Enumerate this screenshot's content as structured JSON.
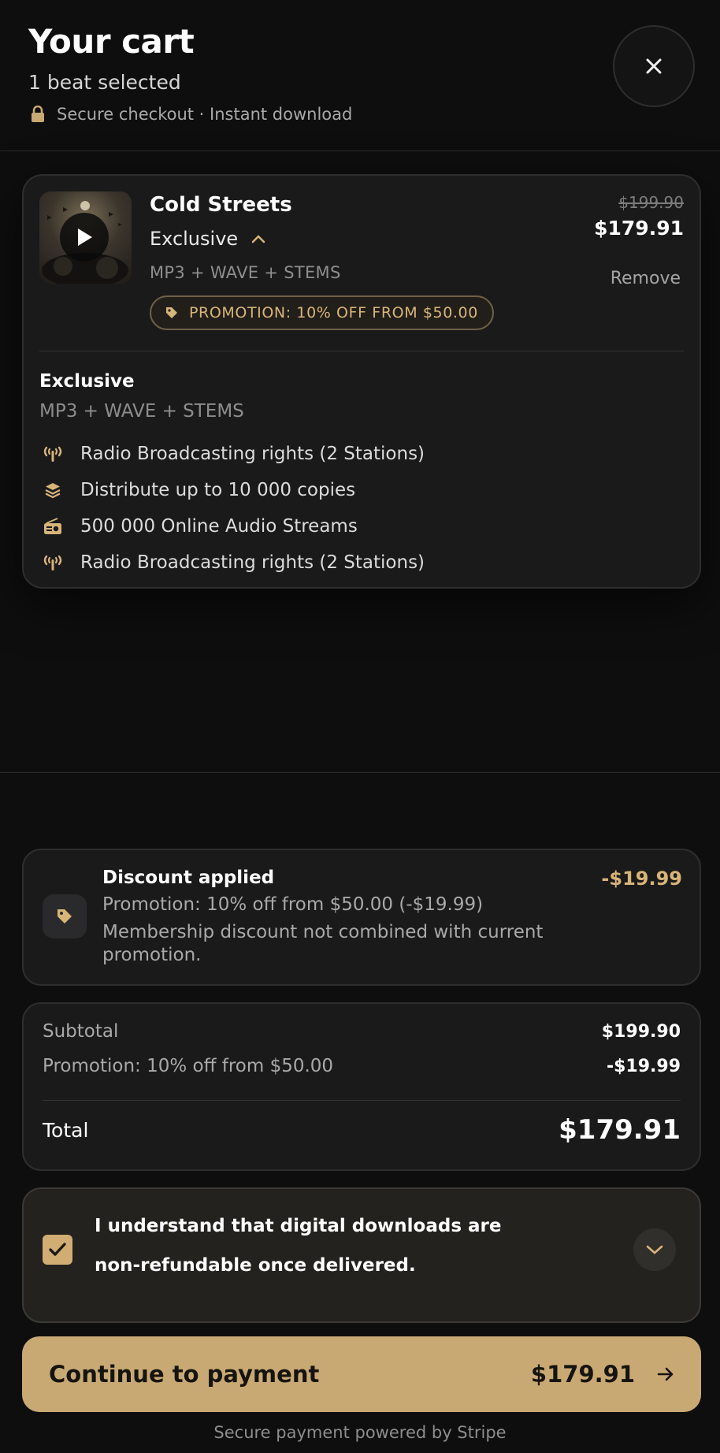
{
  "header": {
    "title": "Your cart",
    "subtitle": "1 beat selected",
    "secure_text": "Secure checkout · Instant download"
  },
  "item": {
    "name": "Cold Streets",
    "license": "Exclusive",
    "formats": "MP3 + WAVE + STEMS",
    "promo_pill": "PROMOTION: 10% OFF FROM $50.00",
    "old_price": "$199.90",
    "new_price": "$179.91",
    "remove_label": "Remove",
    "details": {
      "title": "Exclusive",
      "formats": "MP3 + WAVE + STEMS",
      "features": [
        {
          "icon": "radio-antenna-icon",
          "text": "Radio Broadcasting rights (2 Stations)"
        },
        {
          "icon": "layers-icon",
          "text": "Distribute up to 10 000 copies"
        },
        {
          "icon": "radio-icon",
          "text": "500 000 Online Audio Streams"
        },
        {
          "icon": "radio-antenna-icon",
          "text": "Radio Broadcasting rights (2 Stations)"
        }
      ]
    }
  },
  "discount": {
    "title": "Discount applied",
    "line1": "Promotion: 10% off from $50.00 (-$19.99)",
    "line2": "Membership discount not combined with current promotion.",
    "amount": "-$19.99"
  },
  "summary": {
    "subtotal_label": "Subtotal",
    "subtotal_value": "$199.90",
    "promo_label": "Promotion: 10% off from $50.00",
    "promo_value": "-$19.99",
    "total_label": "Total",
    "total_value": "$179.91"
  },
  "consent": {
    "checked": true,
    "text": "I understand that digital downloads are non-refundable once delivered."
  },
  "pay_button": {
    "label": "Continue to payment",
    "amount": "$179.91"
  },
  "footer": "Secure payment powered by Stripe",
  "colors": {
    "accent": "#c9a973",
    "accent_text": "#d7b478",
    "background": "#0e0e0f",
    "card": "#1a1a1b"
  }
}
